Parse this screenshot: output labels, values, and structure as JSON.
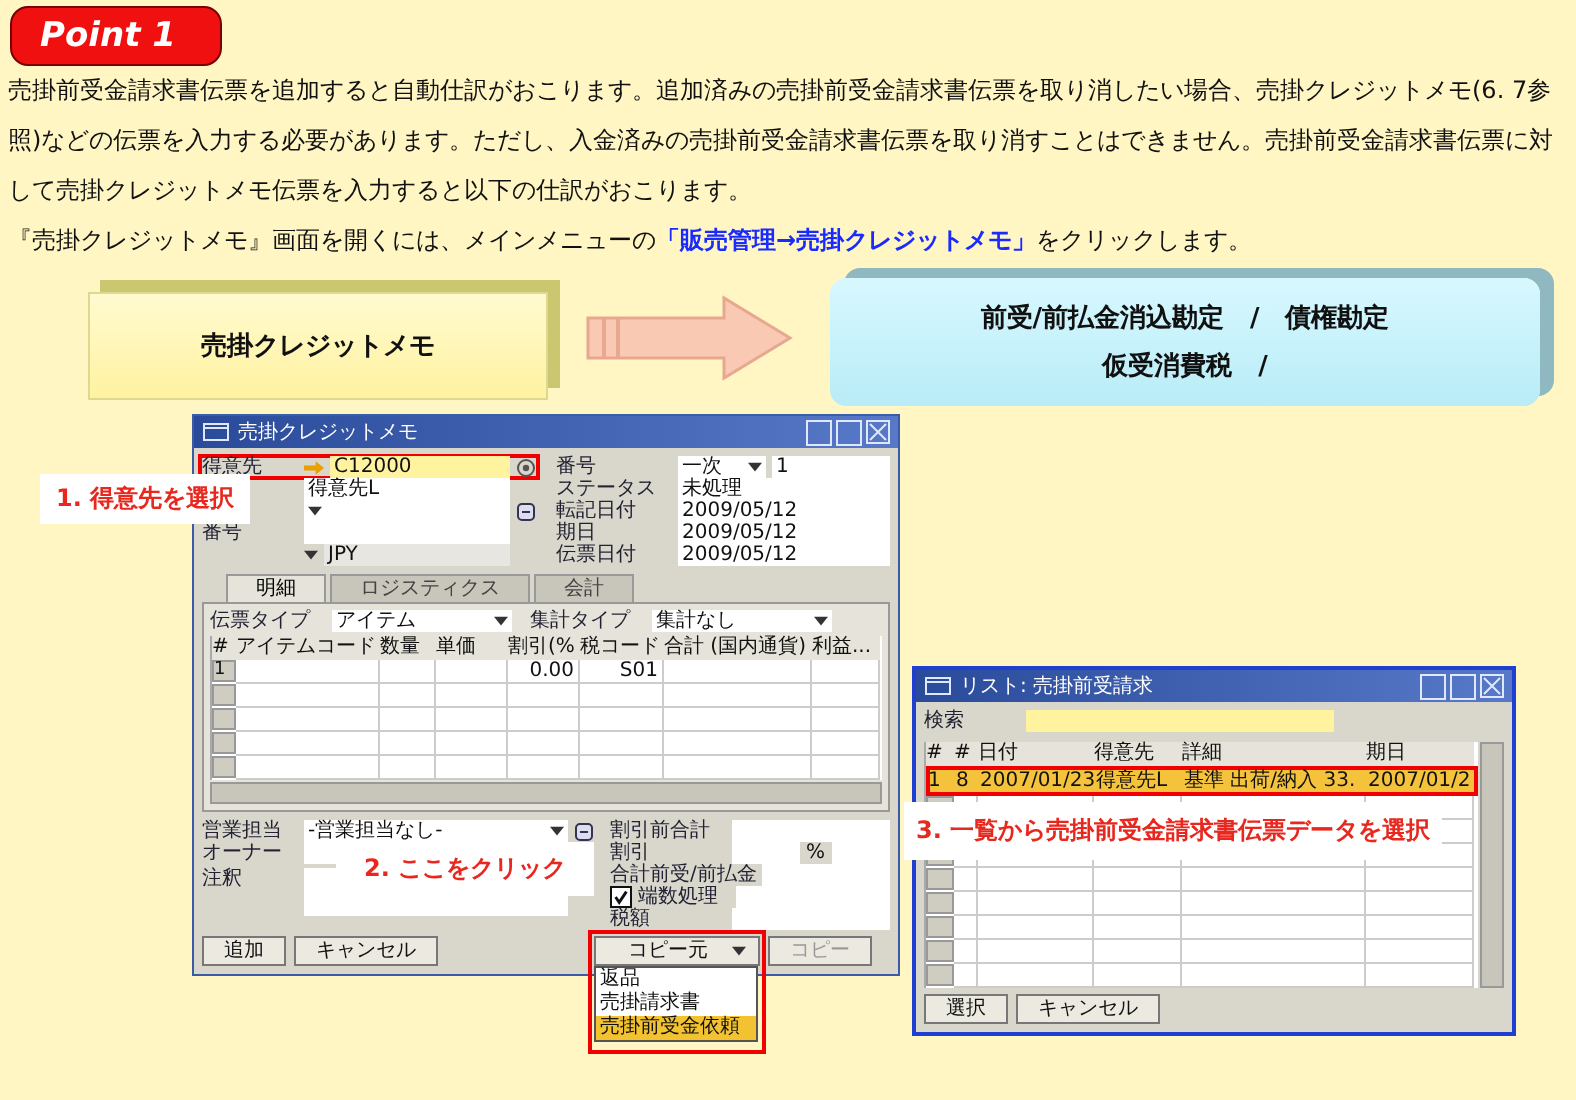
{
  "badge": "Point 1",
  "paragraphs": [
    "売掛前受金請求書伝票を追加すると自動仕訳がおこります。追加済みの売掛前受金請求書伝票を取り消したい場合、売掛クレジットメモ(6. 7参照)などの伝票を入力する必要があります。ただし、入金済みの売掛前受金請求書伝票を取り消すことはできません。売掛前受金請求書伝票に対して売掛クレジットメモ伝票を入力すると以下の仕訳がおこります。",
    "『売掛クレジットメモ』画面を開くには、メインメニューの**「販売管理→売掛クレジットメモ」**をクリックします。"
  ],
  "flow": {
    "source": "売掛クレジットメモ",
    "targets": [
      "前受/前払金消込勘定　/　債権勘定",
      "仮受消費税　/"
    ]
  },
  "credit_memo_window": {
    "title": "売掛クレジットメモ",
    "header_left": [
      {
        "kind": "link",
        "label": "得意先",
        "value": "C12000",
        "highlighted": true
      },
      {
        "kind": "text",
        "value": "得意先L"
      },
      {
        "kind": "select"
      },
      {
        "kind": "text",
        "label": "番号"
      },
      {
        "kind": "currency",
        "value": "JPY"
      }
    ],
    "header_right": [
      {
        "label": "番号",
        "select": "一次",
        "value": "1"
      },
      {
        "label": "ステータス",
        "value": "未処理"
      },
      {
        "label": "転記日付",
        "value": "2009/05/12"
      },
      {
        "label": "期日",
        "value": "2009/05/12"
      },
      {
        "label": "伝票日付",
        "value": "2009/05/12"
      }
    ],
    "tabs": [
      {
        "label": "明細",
        "selected": true
      },
      {
        "label": "ロジスティクス",
        "selected": false
      },
      {
        "label": "会計",
        "selected": false
      }
    ],
    "type_fields": [
      {
        "label": "伝票タイプ",
        "value": "アイテム"
      },
      {
        "label": "集計タイプ",
        "value": "集計なし"
      }
    ],
    "table": {
      "columns": [
        "#",
        "アイテムコード",
        "数量",
        "単価",
        "割引(%",
        "税コード",
        "合計 (国内通貨)",
        "利益..."
      ],
      "rows": [
        {
          "number": "1",
          "discount": "0.00",
          "tax_code": "S01"
        }
      ]
    },
    "bottom_left": [
      {
        "kind": "select",
        "label": "営業担当",
        "value": "-営業担当なし-"
      },
      {
        "kind": "text",
        "label": "オーナー"
      },
      {
        "kind": "note",
        "label": "注釈"
      }
    ],
    "bottom_right": [
      {
        "kind": "field",
        "label": "割引前合計"
      },
      {
        "kind": "percent",
        "label": "割引",
        "suffix": "%"
      },
      {
        "kind": "field",
        "label": "合計前受/前払金"
      },
      {
        "kind": "checkbox",
        "label": "端数処理",
        "checked": true
      },
      {
        "kind": "field",
        "label": "税額"
      }
    ],
    "buttons": [
      "追加",
      "キャンセル"
    ],
    "copy_from": {
      "label": "コピー元",
      "highlighted": true,
      "menu": [
        {
          "label": "返品",
          "selected": false
        },
        {
          "label": "売掛請求書",
          "selected": false
        },
        {
          "label": "売掛前受金依頼",
          "selected": true
        }
      ]
    },
    "copy_to": "コピー"
  },
  "list_window": {
    "title": "リスト: 売掛前受請求",
    "search_label": "検索",
    "columns": [
      "#",
      "#",
      "日付",
      "得意先",
      "詳細",
      "期日"
    ],
    "rows": [
      {
        "cells": [
          "1",
          "8",
          "2007/01/23",
          "得意先L",
          "基準 出荷/納入 33.",
          "2007/01/2"
        ],
        "selected": true
      }
    ],
    "buttons": [
      "選択",
      "キャンセル"
    ]
  },
  "callouts": [
    "1. 得意先を選択",
    "2. ここをクリック",
    "3. 一覧から売掛前受金請求書伝票データを選択"
  ]
}
